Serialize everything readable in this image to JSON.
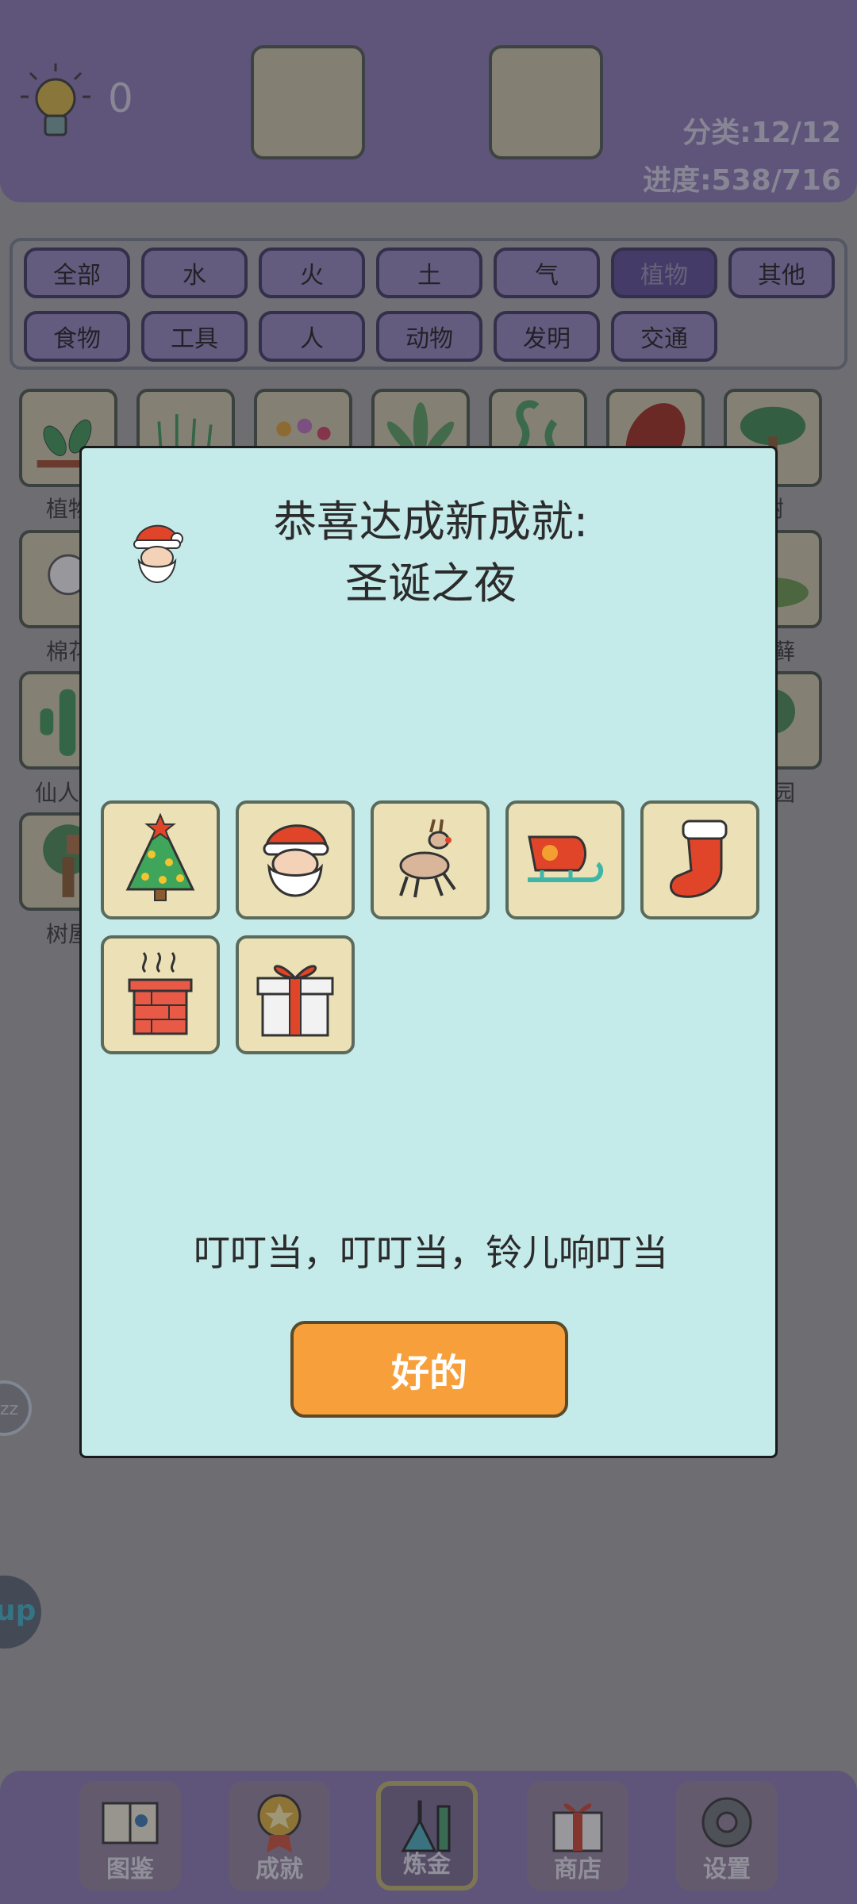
{
  "header": {
    "hint_count": "0",
    "category_stat": "分类:12/12",
    "progress_stat": "进度:538/716"
  },
  "filters": [
    {
      "label": "全部",
      "active": false
    },
    {
      "label": "水",
      "active": false
    },
    {
      "label": "火",
      "active": false
    },
    {
      "label": "土",
      "active": false
    },
    {
      "label": "气",
      "active": false
    },
    {
      "label": "植物",
      "active": true
    },
    {
      "label": "其他",
      "active": false
    },
    {
      "label": "食物",
      "active": false
    },
    {
      "label": "工具",
      "active": false
    },
    {
      "label": "人",
      "active": false
    },
    {
      "label": "动物",
      "active": false
    },
    {
      "label": "发明",
      "active": false
    },
    {
      "label": "交通",
      "active": false
    }
  ],
  "grid_labels": {
    "row1_left": "植物",
    "row1_right": "树",
    "row2_left": "棉花",
    "row2_right": "苔藓",
    "row3_left": "仙人掌",
    "row3_right": "花园",
    "row4_left": "树屋"
  },
  "side_buttons": {
    "zz": "zz",
    "up": "up"
  },
  "modal": {
    "title_line1": "恭喜达成新成就:",
    "title_line2": "圣诞之夜",
    "items": [
      "christmas-tree-icon",
      "santa-icon",
      "reindeer-icon",
      "sleigh-icon",
      "stocking-icon",
      "chimney-icon",
      "gift-icon"
    ],
    "quote": "叮叮当，叮叮当，铃儿响叮当",
    "ok_label": "好的"
  },
  "nav": [
    {
      "label": "图鉴",
      "icon": "book-icon"
    },
    {
      "label": "成就",
      "icon": "medal-icon"
    },
    {
      "label": "炼金",
      "icon": "flask-icon",
      "active": true
    },
    {
      "label": "商店",
      "icon": "gift-box-icon"
    },
    {
      "label": "设置",
      "icon": "gear-icon"
    }
  ],
  "colors": {
    "header_bg": "#8c7ab5",
    "modal_bg": "#c5eaea",
    "ok_button": "#f7a03b",
    "active_filter": "#5d4b94"
  }
}
